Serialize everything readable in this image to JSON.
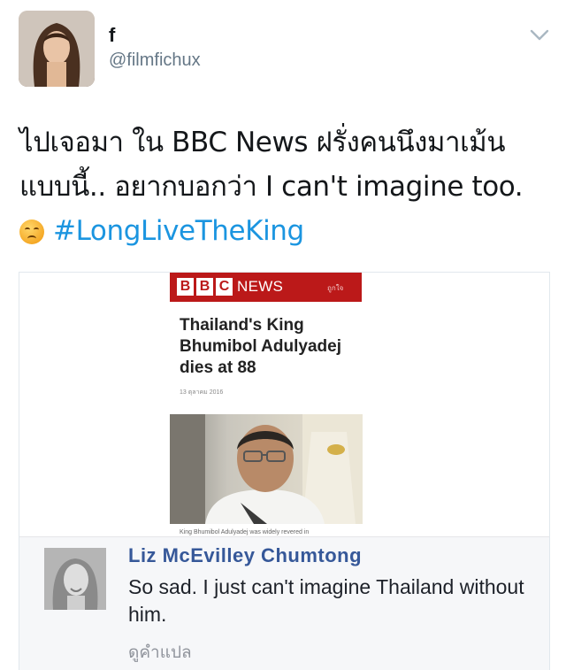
{
  "header": {
    "display_name": "f",
    "handle": "@filmfichux",
    "menu_icon": "chevron-down-icon"
  },
  "tweet": {
    "line1": "ไปเจอมา ใน BBC News ฝรั่งคนนึงมาเม้น",
    "line2": "แบบนี้.. อยากบอกว่า I can't imagine too.",
    "emoji": "disappointed-face-emoji",
    "hashtag": "#LongLiveTheKing",
    "hashtag_color": "#1b95e0"
  },
  "media": {
    "brand_letters": [
      "B",
      "B",
      "C"
    ],
    "brand_word": "NEWS",
    "brand_color": "#bb1919",
    "like_text": "ถูกใจ",
    "headline": "Thailand's King Bhumibol Adulyadej dies at 88",
    "date": "13 ตุลาคม 2016",
    "photo_caption": "King Bhumibol Adulyadej was widely revered in",
    "comment": {
      "author": "Liz McEvilley Chumtong",
      "text": "So sad. I just can't imagine Thailand without him.",
      "translate_link": "ดูคำแปล"
    }
  }
}
